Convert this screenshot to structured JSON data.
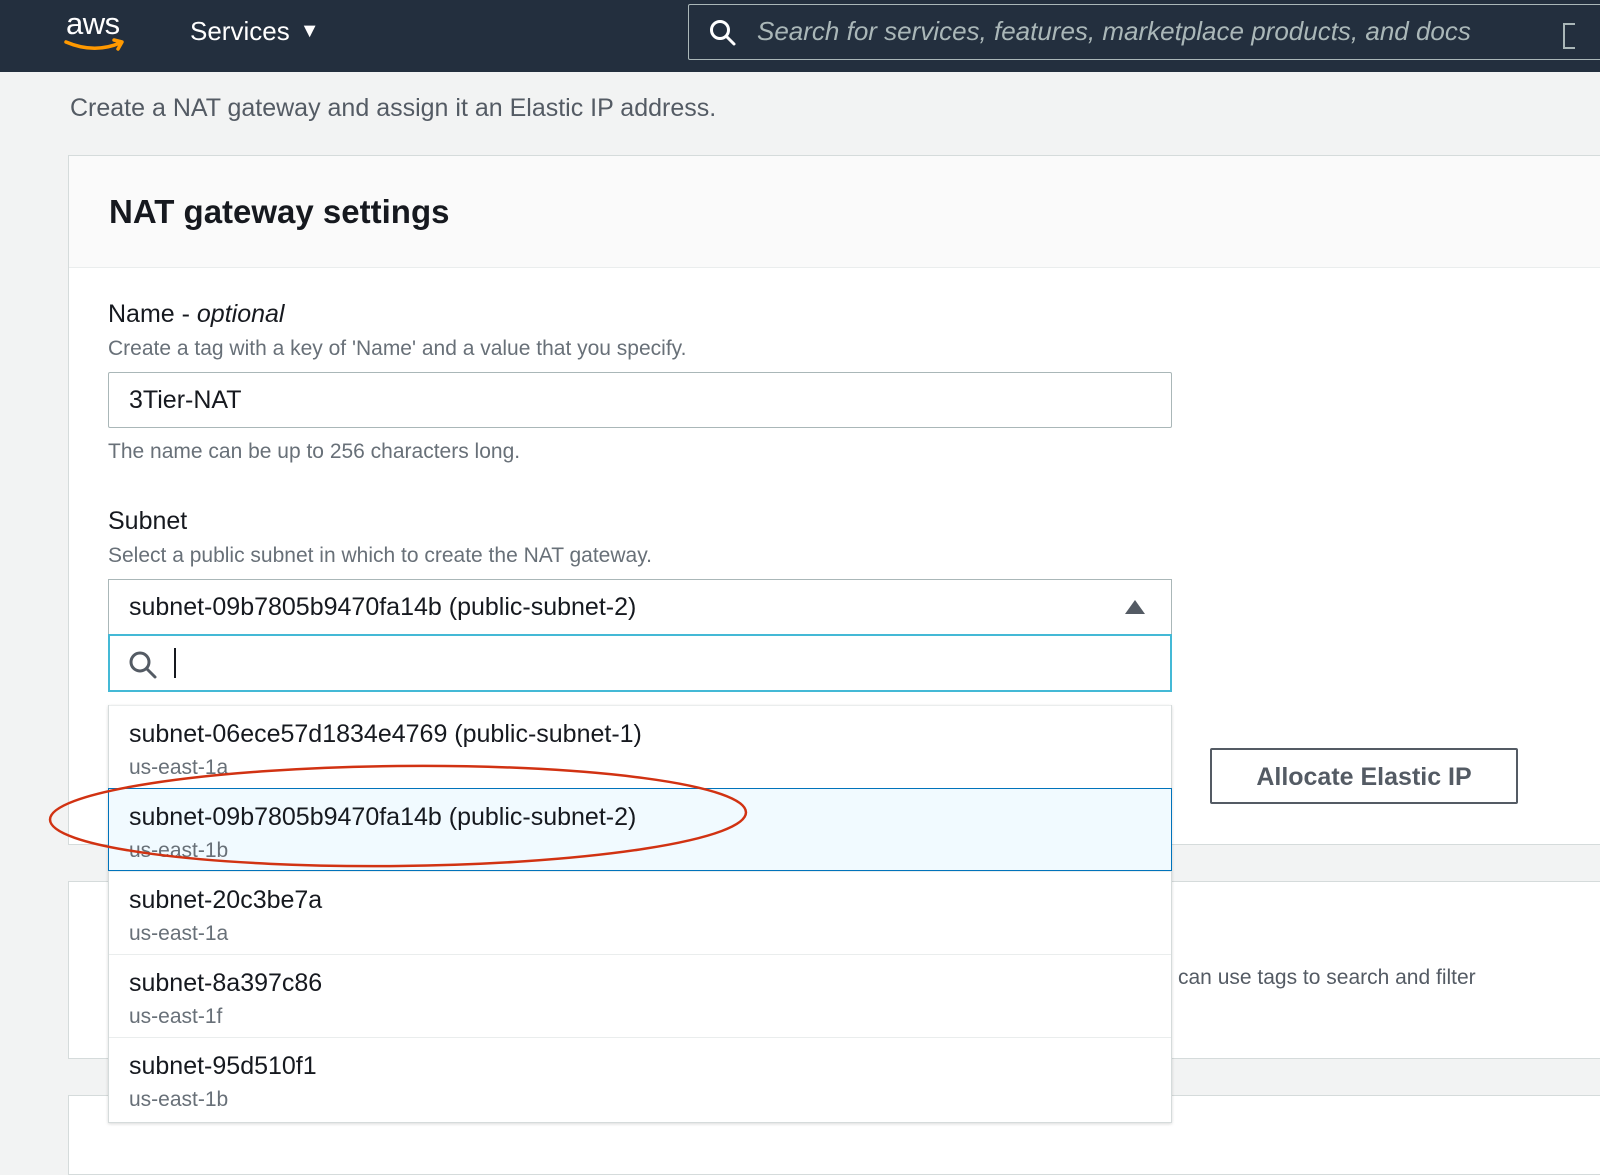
{
  "topnav": {
    "logo_text": "aws",
    "services_label": "Services",
    "search_placeholder": "Search for services, features, marketplace products, and docs"
  },
  "page": {
    "intro": "Create a NAT gateway and assign it an Elastic IP address."
  },
  "panel": {
    "title": "NAT gateway settings",
    "name_label": "Name - ",
    "name_label_optional": "optional",
    "name_desc": "Create a tag with a key of 'Name' and a value that you specify.",
    "name_value": "3Tier-NAT",
    "name_constraint": "The name can be up to 256 characters long.",
    "subnet_label": "Subnet",
    "subnet_desc": "Select a public subnet in which to create the NAT gateway.",
    "subnet_selected": "subnet-09b7805b9470fa14b (public-subnet-2)",
    "subnet_options": [
      {
        "id": "subnet-06ece57d1834e4769 (public-subnet-1)",
        "az": "us-east-1a"
      },
      {
        "id": "subnet-09b7805b9470fa14b (public-subnet-2)",
        "az": "us-east-1b"
      },
      {
        "id": "subnet-20c3be7a",
        "az": "us-east-1a"
      },
      {
        "id": "subnet-8a397c86",
        "az": "us-east-1f"
      },
      {
        "id": "subnet-95d510f1",
        "az": "us-east-1b"
      }
    ],
    "allocate_button": "Allocate Elastic IP"
  },
  "tags_panel": {
    "partial_text": "can use tags to search and filter"
  },
  "colors": {
    "nav_bg": "#232f3e",
    "selected_bg": "#f1faff",
    "selected_border": "#0073bb",
    "focus_border": "#44b9d6",
    "annotation": "#d13212"
  },
  "icons": [
    "search-icon",
    "caret-down-icon",
    "caret-up-icon",
    "aws-smile-logo"
  ]
}
